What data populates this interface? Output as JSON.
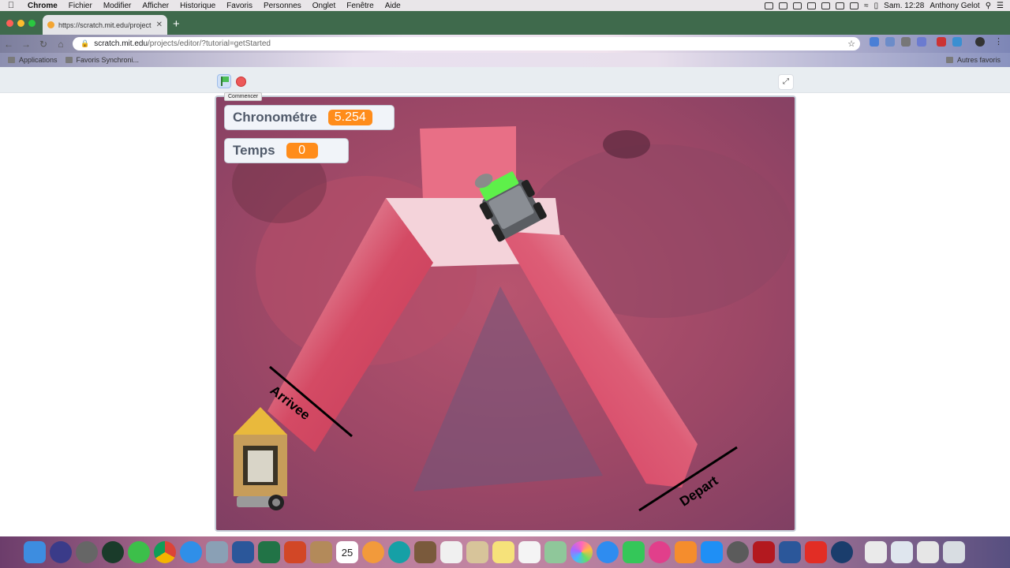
{
  "menubar": {
    "app_name": "Chrome",
    "items": [
      "Fichier",
      "Modifier",
      "Afficher",
      "Historique",
      "Favoris",
      "Personnes",
      "Onglet",
      "Fenêtre",
      "Aide"
    ],
    "clock": "Sam. 12:28",
    "user": "Anthony Gelot"
  },
  "browser": {
    "tab_title": "https://scratch.mit.edu/project",
    "url_host": "scratch.mit.edu",
    "url_path": "/projects/editor/?tutorial=getStarted",
    "bookmarks": [
      "Applications",
      "Favoris Synchroni..."
    ],
    "bookmarks_right": "Autres favoris"
  },
  "stage_controls": {
    "tooltip": "Commencer"
  },
  "monitors": [
    {
      "label": "Chronométre",
      "value": "5.254"
    },
    {
      "label": "Temps",
      "value": "0"
    }
  ],
  "stage": {
    "finish_label": "Arrivee",
    "start_label": "Depart"
  },
  "colors": {
    "monitor_value": "#ff8c1a",
    "tabstrip": "#3f6a4c",
    "background_mat": "#a54d6a",
    "track": "#d9435f"
  },
  "dock": {
    "apps": [
      "finder-icon",
      "siri-icon",
      "launchpad-icon",
      "notability-icon",
      "sync-icon",
      "chrome-icon",
      "safari-icon",
      "preview-icon",
      "word-icon",
      "excel-icon",
      "powerpoint-icon",
      "archive-icon",
      "calendar-icon",
      "photos-icon",
      "arduino-icon",
      "book-icon",
      "textedit-icon",
      "contacts-icon",
      "notes-icon",
      "reminders-icon",
      "maps-icon",
      "photos2-icon",
      "messages-icon",
      "facetime-icon",
      "itunes-icon",
      "ibooks-icon",
      "appstore-icon",
      "settings-icon",
      "filezilla-icon",
      "word2-icon",
      "acrobat-icon",
      "quicktime-icon",
      "documents-icon",
      "finder2-icon",
      "downloads-icon",
      "trash-icon"
    ],
    "calendar_day": "25"
  }
}
